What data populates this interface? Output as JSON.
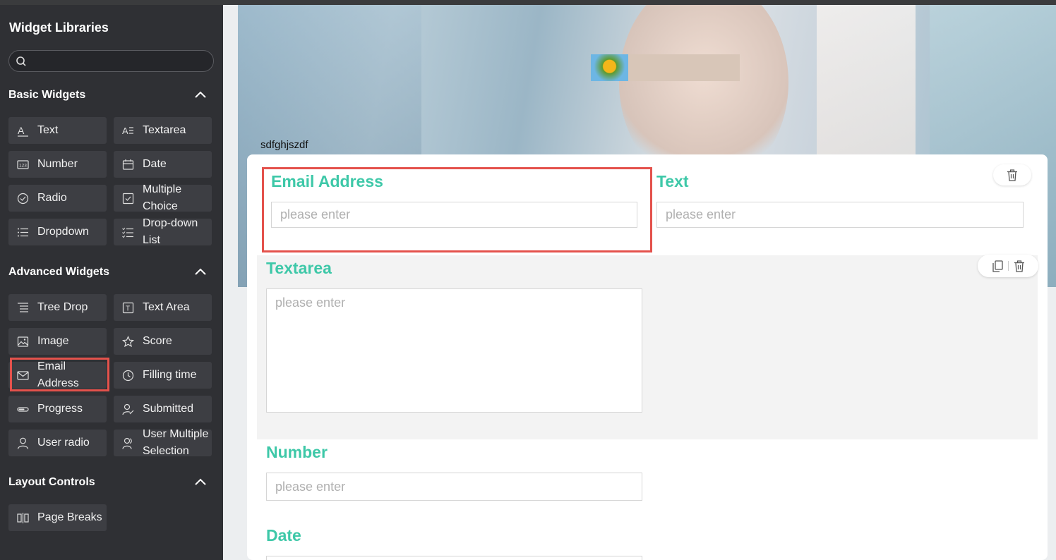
{
  "sidebar": {
    "title": "Widget Libraries",
    "search": {
      "placeholder": ""
    },
    "basic": {
      "title": "Basic Widgets",
      "items": [
        "Text",
        "Textarea",
        "Number",
        "Date",
        "Radio",
        "Multiple Choice",
        "Dropdown",
        "Drop-down List"
      ]
    },
    "advanced": {
      "title": "Advanced Widgets",
      "items": [
        "Tree Drop",
        "Text Area",
        "Image",
        "Score",
        "Email Address",
        "Filling time",
        "Progress",
        "Submitted",
        "User radio",
        "User Multiple Selection"
      ]
    },
    "layout": {
      "title": "Layout Controls",
      "items": [
        "Page Breaks"
      ]
    }
  },
  "banner": {
    "text": "sdfghjszdf"
  },
  "form": {
    "email": {
      "label": "Email Address",
      "placeholder": "please enter"
    },
    "text": {
      "label": "Text",
      "placeholder": "please enter"
    },
    "textarea": {
      "label": "Textarea",
      "placeholder": "please enter"
    },
    "number": {
      "label": "Number",
      "placeholder": "please enter"
    },
    "date": {
      "label": "Date"
    }
  },
  "colors": {
    "accent": "#3ec8a8",
    "highlight": "#e4524c",
    "sidebar_bg": "#2f3034"
  }
}
